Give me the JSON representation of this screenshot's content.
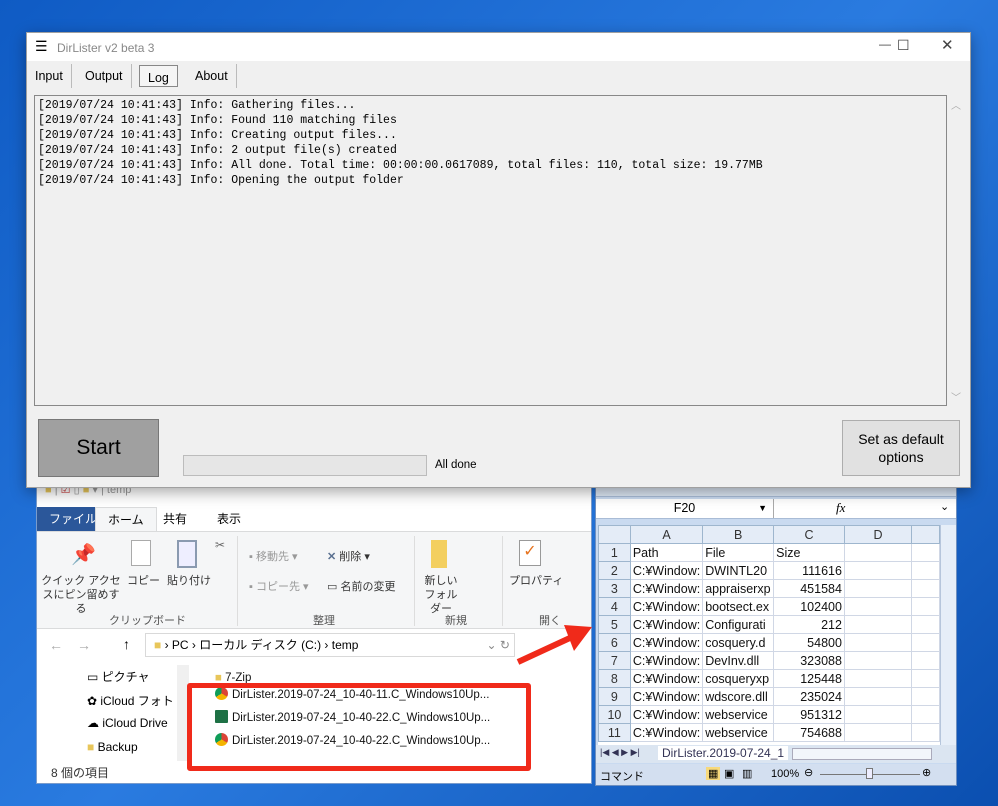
{
  "dirlister": {
    "title": "DirLister v2 beta 3",
    "tabs": [
      "Input",
      "Output",
      "Log",
      "About"
    ],
    "active_tab": "Log",
    "log_lines": [
      "[2019/07/24 10:41:43] Info: Gathering files...",
      "[2019/07/24 10:41:43] Info: Found 110 matching files",
      "[2019/07/24 10:41:43] Info: Creating output files...",
      "[2019/07/24 10:41:43] Info: 2 output file(s) created",
      "[2019/07/24 10:41:43] Info: All done. Total time: 00:00:00.0617089, total files: 110, total size: 19.77MB",
      "[2019/07/24 10:41:43] Info: Opening the output folder"
    ],
    "start_label": "Start",
    "progress": 0,
    "status_text": "All done",
    "set_default_label": "Set as default options"
  },
  "explorer": {
    "qat_title": "temp",
    "ribbon_tabs": [
      "ファイル",
      "ホーム",
      "共有",
      "表示"
    ],
    "clipboard": {
      "pin": "クイック アクセスにピン留めする",
      "copy": "コピー",
      "paste": "貼り付け",
      "group": "クリップボード"
    },
    "organize": {
      "move": "移動先",
      "copy_to": "コピー先",
      "delete": "削除",
      "rename": "名前の変更",
      "group": "整理"
    },
    "new": {
      "folder": "新しいフォルダー",
      "group": "新規"
    },
    "open": {
      "properties": "プロパティ",
      "group": "開く"
    },
    "breadcrumb": [
      "PC",
      "ローカル ディスク (C:)",
      "temp"
    ],
    "nav_items": [
      "ピクチャ",
      "iCloud フォト",
      "iCloud Drive",
      "Backup"
    ],
    "files": [
      {
        "name": "7-Zip",
        "type": "folder"
      },
      {
        "name": "DirLister.2019-07-24_10-40-11.C_Windows10Up...",
        "type": "chrome"
      },
      {
        "name": "DirLister.2019-07-24_10-40-22.C_Windows10Up...",
        "type": "excel"
      },
      {
        "name": "DirLister.2019-07-24_10-40-22.C_Windows10Up...",
        "type": "chrome"
      }
    ],
    "item_count": "8 個の項目"
  },
  "excel": {
    "name_box": "F20",
    "fx": "fx",
    "columns": [
      "A",
      "B",
      "C",
      "D"
    ],
    "rows": [
      [
        "1",
        "Path",
        "File",
        "Size"
      ],
      [
        "2",
        "C:¥Window:",
        "DWINTL20",
        "111616"
      ],
      [
        "3",
        "C:¥Window:",
        "appraiserxp",
        "451584"
      ],
      [
        "4",
        "C:¥Window:",
        "bootsect.ex",
        "102400"
      ],
      [
        "5",
        "C:¥Window:",
        "Configurati",
        "212"
      ],
      [
        "6",
        "C:¥Window:",
        "cosquery.d",
        "54800"
      ],
      [
        "7",
        "C:¥Window:",
        "DevInv.dll",
        "323088"
      ],
      [
        "8",
        "C:¥Window:",
        "cosqueryxp",
        "125448"
      ],
      [
        "9",
        "C:¥Window:",
        "wdscore.dll",
        "235024"
      ],
      [
        "10",
        "C:¥Window:",
        "webservice",
        "951312"
      ],
      [
        "11",
        "C:¥Window:",
        "webservice",
        "754688"
      ]
    ],
    "sheet_tab": "DirLister.2019-07-24_1",
    "status_mode": "コマンド",
    "zoom": "100%"
  },
  "colors": {
    "accent_red": "#f02a1a",
    "ribbon_file_tab": "#2b579a"
  }
}
